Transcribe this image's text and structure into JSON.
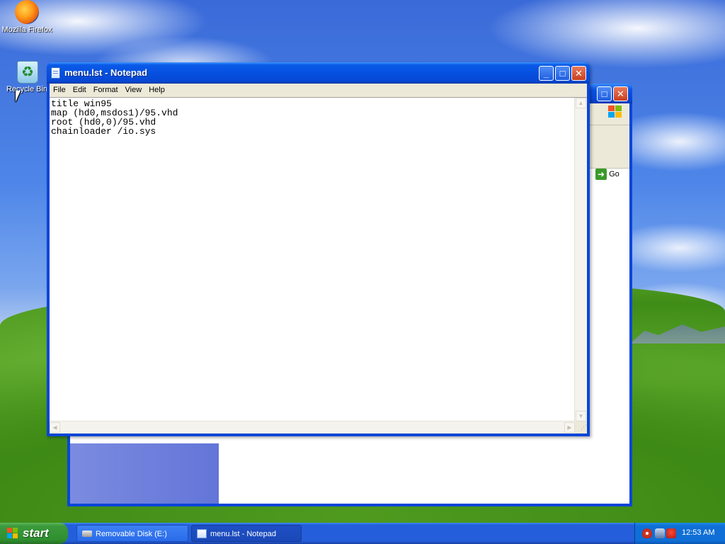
{
  "desktop": {
    "icons": [
      {
        "label": "Mozilla Firefox",
        "icon": "firefox-icon"
      },
      {
        "label": "Recycle Bin",
        "icon": "recycle-bin-icon"
      }
    ]
  },
  "background_window": {
    "go_label": "Go"
  },
  "notepad": {
    "title": "menu.lst - Notepad",
    "menu": [
      "File",
      "Edit",
      "Format",
      "View",
      "Help"
    ],
    "content": "title win95\nmap (hd0,msdos1)/95.vhd\nroot (hd0,0)/95.vhd\nchainloader /io.sys"
  },
  "taskbar": {
    "start_label": "start",
    "tasks": [
      {
        "label": "Removable Disk (E:)",
        "active": false
      },
      {
        "label": "menu.lst - Notepad",
        "active": true
      }
    ],
    "clock": "12:53 AM"
  },
  "colors": {
    "title_blue": "#0a5ae8",
    "start_green": "#3c9a3c",
    "menu_bg": "#ece9d8"
  }
}
